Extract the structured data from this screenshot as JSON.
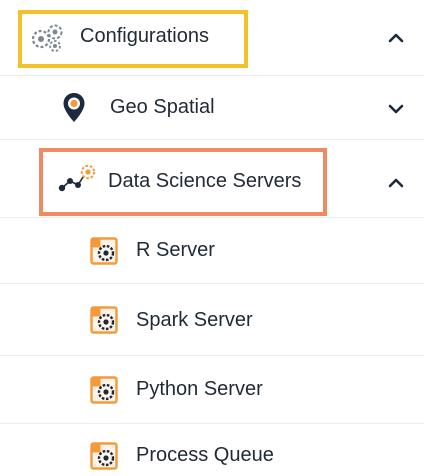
{
  "colors": {
    "highlight_primary": "#f5c12b",
    "highlight_secondary": "#ef8a63",
    "accent_orange": "#f59a3a",
    "accent_navy": "#1b2a3d",
    "separator": "#ececec"
  },
  "menu": {
    "configurations": {
      "label": "Configurations",
      "icon": "gears-icon",
      "state": "expanded"
    },
    "geo_spatial": {
      "label": "Geo Spatial",
      "icon": "map-pin-icon",
      "state": "collapsed"
    },
    "data_science_servers": {
      "label": "Data Science Servers",
      "icon": "data-science-icon",
      "state": "expanded"
    },
    "servers": [
      {
        "label": "R Server",
        "icon": "server-gear-icon"
      },
      {
        "label": "Spark Server",
        "icon": "server-gear-icon"
      },
      {
        "label": "Python Server",
        "icon": "server-gear-icon"
      },
      {
        "label": "Process Queue",
        "icon": "server-gear-icon"
      }
    ]
  }
}
